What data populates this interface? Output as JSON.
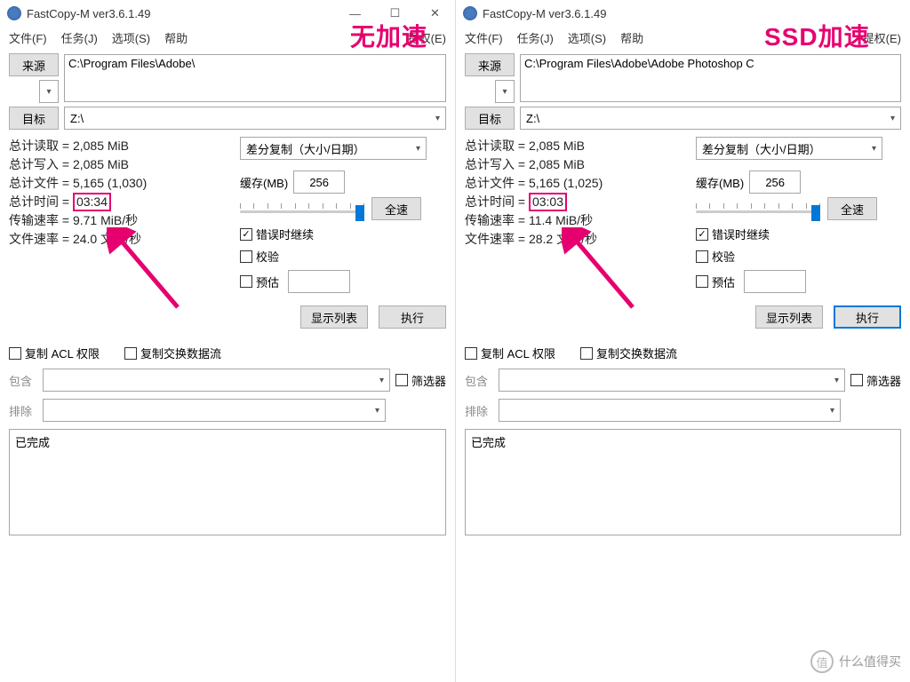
{
  "overlay": {
    "left_label": "无加速",
    "right_label": "SSD加速"
  },
  "app": {
    "title": "FastCopy-M ver3.6.1.49",
    "menu": {
      "file": "文件(F)",
      "task": "任务(J)",
      "option": "选项(S)",
      "help": "帮助",
      "auth": "提权(E)"
    }
  },
  "left": {
    "src_btn": "来源",
    "src_val": "C:\\Program Files\\Adobe\\",
    "dst_btn": "目标",
    "dst_val": "Z:\\",
    "stats": {
      "read_lbl": "总计读取 =",
      "read_val": "2,085 MiB",
      "write_lbl": "总计写入 =",
      "write_val": "2,085 MiB",
      "files_lbl": "总计文件 =",
      "files_val": "5,165 (1,030)",
      "time_lbl": "总计时间 =",
      "time_val": "03:34",
      "speed_lbl": "传输速率 =",
      "speed_val": "9.71 MiB/秒",
      "frate_lbl": "文件速率 =",
      "frate_val": "24.0 文件/秒"
    },
    "mode": "差分复制（大小/日期）",
    "cache_lbl": "缓存(MB)",
    "cache_val": "256",
    "full_speed": "全速",
    "cb": {
      "cont": "错误时继续",
      "verify": "校验",
      "estimate": "预估"
    },
    "show_list": "显示列表",
    "exec": "执行",
    "acl": "复制 ACL 权限",
    "altstream": "复制交换数据流",
    "include_lbl": "包含",
    "exclude_lbl": "排除",
    "filter_btn": "筛选器",
    "log": "已完成"
  },
  "right": {
    "src_btn": "来源",
    "src_val": "C:\\Program Files\\Adobe\\Adobe Photoshop C",
    "dst_btn": "目标",
    "dst_val": "Z:\\",
    "stats": {
      "read_lbl": "总计读取 =",
      "read_val": "2,085 MiB",
      "write_lbl": "总计写入 =",
      "write_val": "2,085 MiB",
      "files_lbl": "总计文件 =",
      "files_val": "5,165 (1,025)",
      "time_lbl": "总计时间 =",
      "time_val": "03:03",
      "speed_lbl": "传输速率 =",
      "speed_val": "11.4 MiB/秒",
      "frate_lbl": "文件速率 =",
      "frate_val": "28.2 文件/秒"
    },
    "mode": "差分复制（大小/日期）",
    "cache_lbl": "缓存(MB)",
    "cache_val": "256",
    "full_speed": "全速",
    "cb": {
      "cont": "错误时继续",
      "verify": "校验",
      "estimate": "预估"
    },
    "show_list": "显示列表",
    "exec": "执行",
    "acl": "复制 ACL 权限",
    "altstream": "复制交换数据流",
    "include_lbl": "包含",
    "exclude_lbl": "排除",
    "filter_btn": "筛选器",
    "log": "已完成"
  },
  "watermark": {
    "icon": "值",
    "text": "什么值得买"
  }
}
